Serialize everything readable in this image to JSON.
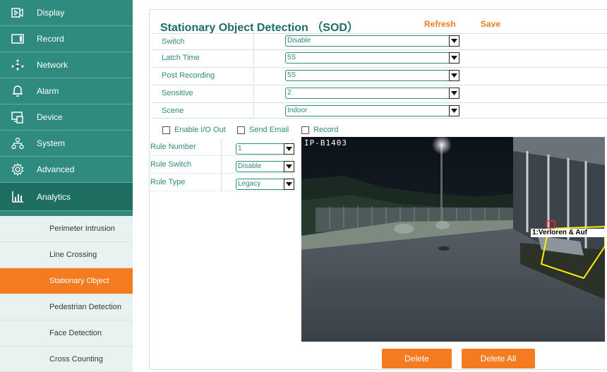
{
  "sidebar": {
    "items": [
      {
        "label": "Display",
        "icon": "display-icon"
      },
      {
        "label": "Record",
        "icon": "record-icon"
      },
      {
        "label": "Network",
        "icon": "network-icon"
      },
      {
        "label": "Alarm",
        "icon": "bell-icon"
      },
      {
        "label": "Device",
        "icon": "device-icon"
      },
      {
        "label": "System",
        "icon": "system-icon"
      },
      {
        "label": "Advanced",
        "icon": "gear-icon"
      },
      {
        "label": "Analytics",
        "icon": "analytics-icon"
      }
    ],
    "sub_items": [
      {
        "label": "Perimeter Intrusion"
      },
      {
        "label": "Line Crossing"
      },
      {
        "label": "Stationary Object"
      },
      {
        "label": "Pedestrian Detection"
      },
      {
        "label": "Face Detection"
      },
      {
        "label": "Cross Counting"
      }
    ]
  },
  "header": {
    "title": "Stationary Object Detection （SOD）",
    "refresh": "Refresh",
    "save": "Save"
  },
  "settings": [
    {
      "label": "Switch",
      "value": "Disable"
    },
    {
      "label": "Latch Time",
      "value": "5S"
    },
    {
      "label": "Post Recording",
      "value": "5S"
    },
    {
      "label": "Sensitive",
      "value": "2"
    },
    {
      "label": "Scene",
      "value": "Indoor"
    }
  ],
  "checkboxes": {
    "enable_io": "Enable I/O Out",
    "send_email": "Send Email",
    "record": "Record"
  },
  "rules": [
    {
      "label": "Rule Number",
      "value": "1"
    },
    {
      "label": "Rule Switch",
      "value": "Disable"
    },
    {
      "label": "Rule Type",
      "value": "Legacy"
    }
  ],
  "video": {
    "camera_name": "IP-B1403",
    "zone_label": "1:Verloren & Auf"
  },
  "buttons": {
    "delete": "Delete",
    "delete_all": "Delete All"
  },
  "colors": {
    "teal": "#2e8b7d",
    "accent": "#f47b20",
    "zone": "#ffee00"
  }
}
